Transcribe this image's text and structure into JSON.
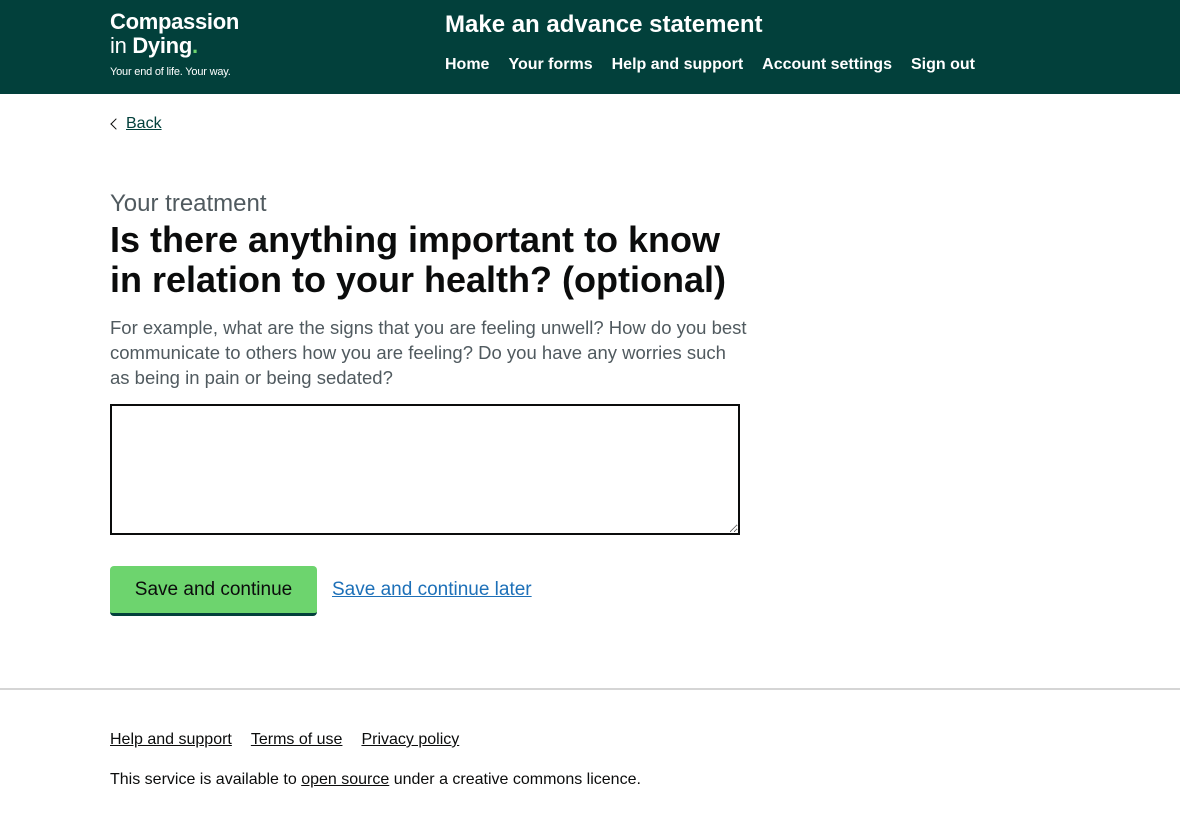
{
  "header": {
    "logo": {
      "line1": "Compassion",
      "line2_prefix": "in",
      "line2_bold": "Dying",
      "line2_dot": ".",
      "tagline": "Your end of life. Your way."
    },
    "service_name": "Make an advance statement",
    "nav": {
      "home": "Home",
      "your_forms": "Your forms",
      "help_support": "Help and support",
      "account_settings": "Account settings",
      "sign_out": "Sign out"
    }
  },
  "back": {
    "label": "Back",
    "icon": "chevron-left-icon"
  },
  "main": {
    "caption": "Your treatment",
    "heading": "Is there anything important to know in relation to your health? (optional)",
    "hint": "For example, what are the signs that you are feeling unwell? How do you best communicate to others how you are feeling? Do you have any worries such as being in pain or being sedated?",
    "textarea_value": "",
    "save_button": "Save and continue",
    "save_later_link": "Save and continue later"
  },
  "footer": {
    "links": {
      "help_support": "Help and support",
      "terms": "Terms of use",
      "privacy": "Privacy policy"
    },
    "licence_prefix": "This service is available to ",
    "licence_link": "open source",
    "licence_suffix": " under a creative commons licence."
  },
  "colors": {
    "header_bg": "#02403b",
    "button_green": "#6dd46e",
    "link_blue": "#1d70b8",
    "hint_grey": "#505a5f"
  }
}
